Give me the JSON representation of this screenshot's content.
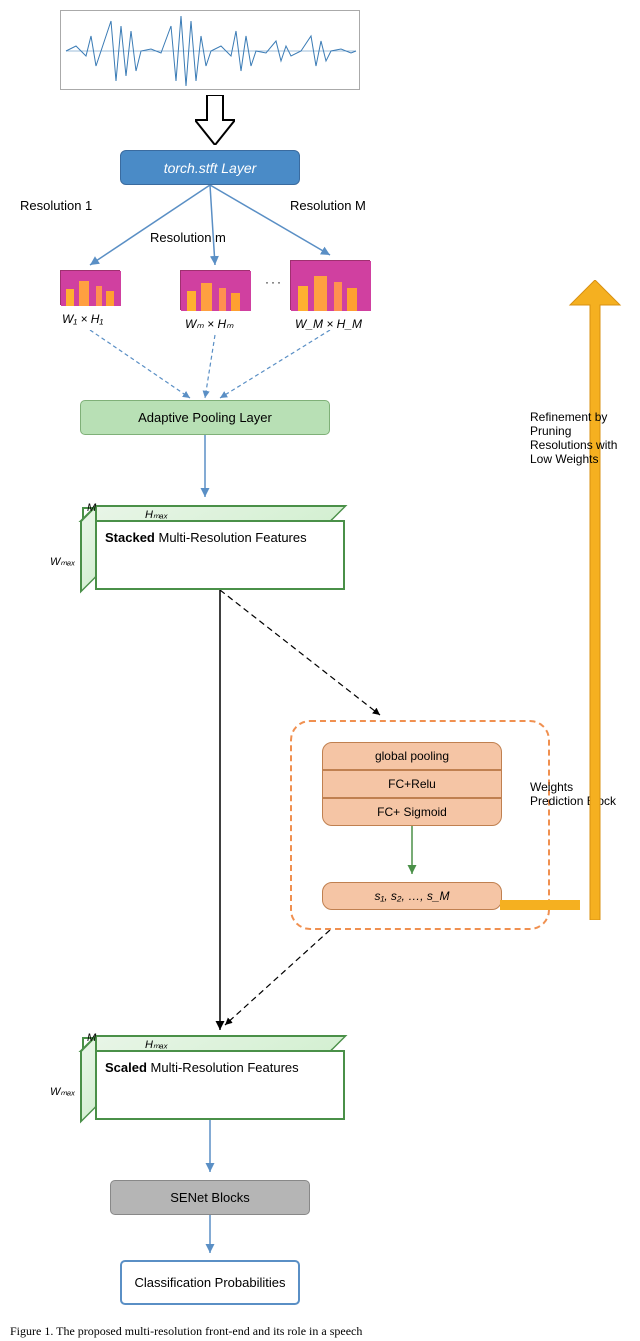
{
  "stft_layer": "torch.stft Layer",
  "resolution_1": "Resolution 1",
  "resolution_m": "Resolution m",
  "resolution_M": "Resolution M",
  "dims_1": "W₁ × H₁",
  "dims_m": "Wₘ × Hₘ",
  "dims_M": "W_M × H_M",
  "dots": "···",
  "adaptive_pool": "Adaptive Pooling Layer",
  "cube1_text_bold": "Stacked",
  "cube1_text_rest": " Multi-Resolution Features",
  "cube2_text_bold": "Scaled",
  "cube2_text_rest": " Multi-Resolution Features",
  "dim_M": "M",
  "dim_Hmax": "Hₘₐₓ",
  "dim_Wmax": "Wₘₐₓ",
  "wb_1": "global pooling",
  "wb_2": "FC+Relu",
  "wb_3": "FC+ Sigmoid",
  "wb_out": "s₁, s₂, …, s_M",
  "wb_label": "Weights Prediction Block",
  "senet": "SENet Blocks",
  "class_prob": "Classification Probabilities",
  "feedback": "Refinement by Pruning Resolutions with Low Weights",
  "caption": "Figure 1. The proposed multi-resolution front-end and its role in a speech"
}
